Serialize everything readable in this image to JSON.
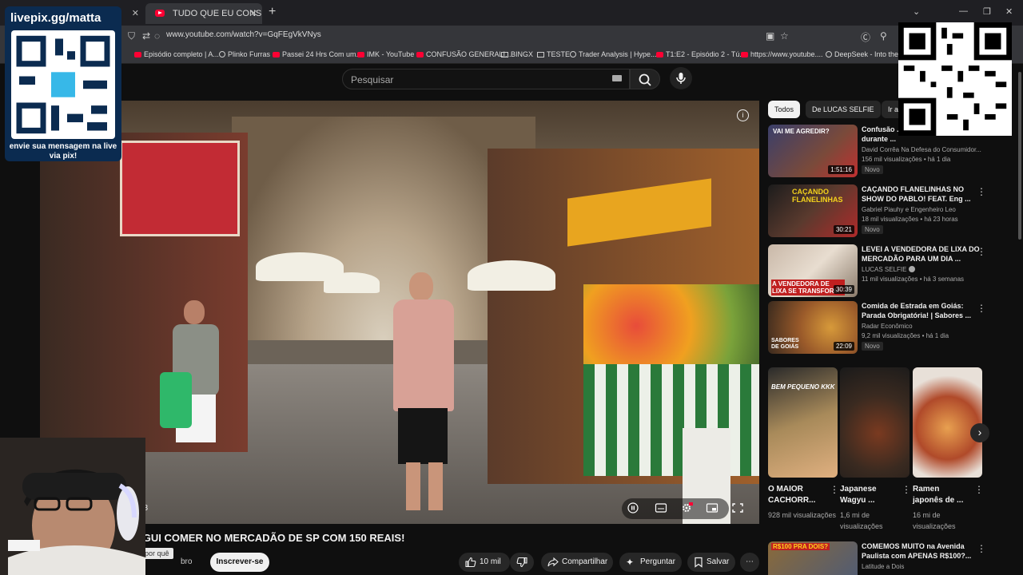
{
  "browser": {
    "tabs": [
      {
        "title": ""
      },
      {
        "title": "TUDO QUE EU CONSEGUI C"
      }
    ],
    "url": "www.youtube.com/watch?v=GqFEgVkVNys",
    "bookmarks": [
      {
        "label": "Episódio completo | A...",
        "icon": "youtube-icon"
      },
      {
        "label": "Plinko Furras",
        "icon": "globe-icon"
      },
      {
        "label": "Passei 24 Hrs Com um...",
        "icon": "youtube-icon"
      },
      {
        "label": "IMK - YouTube",
        "icon": "youtube-icon"
      },
      {
        "label": "CONFUSÃO GENERALI...",
        "icon": "youtube-icon"
      },
      {
        "label": "BINGX",
        "icon": "folder-icon"
      },
      {
        "label": "TESTE",
        "icon": "folder-icon"
      },
      {
        "label": "Trader Analysis | Hype...",
        "icon": "globe-icon"
      },
      {
        "label": "T1:E2 - Episódio 2 - Tú...",
        "icon": "youtube-icon"
      },
      {
        "label": "https://www.youtube....",
        "icon": "youtube-icon"
      },
      {
        "label": "DeepSeek - Into the U...",
        "icon": "globe-icon"
      }
    ]
  },
  "youtube": {
    "search_placeholder": "Pesquisar",
    "video": {
      "timestamp": "58",
      "title": "NSEGUI COMER NO MERCADÃO DE SP COM 150 REAIS!",
      "channel_tip": "Veja por quê",
      "channel_suffix": "bro",
      "subscribe_label": "Inscrever-se",
      "likes": "10 mil",
      "share_label": "Compartilhar",
      "ask_label": "Perguntar",
      "save_label": "Salvar"
    },
    "chips": [
      "Todos",
      "De LUCAS SELFIE",
      "Ir a"
    ],
    "recommendations": [
      {
        "title": "Confusão ... termina em agressão durante ...",
        "channel": "David Corrêa Na Defesa do Consumidor...",
        "meta": "156 mil visualizações • há 1 dia",
        "badge": "Novo",
        "duration": "1:51:16",
        "thumb_text": "VAI ME AGREDIR?"
      },
      {
        "title": "CAÇANDO FLANELINHAS NO SHOW DO PABLO! FEAT. Eng ...",
        "channel": "Gabriel Piauhy e Engenheiro Leo",
        "meta": "18 mil visualizações • há 23 horas",
        "badge": "Novo",
        "duration": "30:21",
        "thumb_text": "CAÇANDO FLANELINHAS"
      },
      {
        "title": "LEVEI A VENDEDORA DE LIXA DO MERCADÃO PARA UM DIA ...",
        "channel": "LUCAS SELFIE",
        "meta": "11 mil visualizações • há 3 semanas",
        "badge": "",
        "duration": "30:39",
        "thumb_text": "A VENDEDORA DE LIXA SE TRANSFORM"
      },
      {
        "title": "Comida de Estrada em Goiás: Parada Obrigatória! | Sabores ...",
        "channel": "Radar Econômico",
        "meta": "9,2 mil visualizações • há 1 dia",
        "badge": "Novo",
        "duration": "22:09",
        "thumb_text": "SABORES DE GOIÁS"
      }
    ],
    "shorts": [
      {
        "title": "O MAIOR CACHORR...",
        "views": "928 mil visualizações",
        "thumb_text": "BEM PEQUENO KKK"
      },
      {
        "title": "Japanese Wagyu ...",
        "views": "1,6 mi de visualizações",
        "thumb_text": ""
      },
      {
        "title": "Ramen japonês de ...",
        "views": "16 mi de visualizações",
        "thumb_text": ""
      }
    ],
    "last_rec": {
      "title": "COMEMOS MUITO na Avenida Paulista com APENAS R$100?...",
      "channel": "Latitude a Dois",
      "thumb_text": "R$100 PRA DOIS?"
    }
  },
  "overlay": {
    "brand": "livepix.gg/matta",
    "message": "envie sua mensagem na live via pix!"
  }
}
